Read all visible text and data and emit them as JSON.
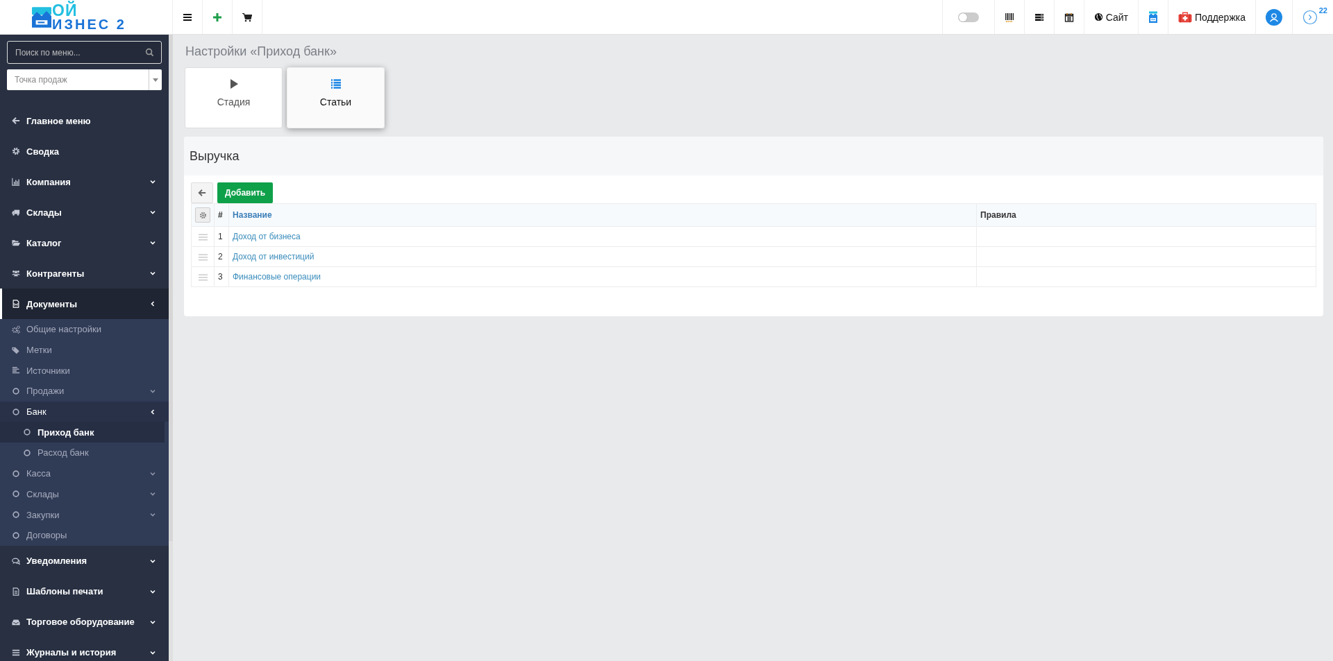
{
  "logo": {
    "line1": "ОЙ",
    "line2": "ИЗНЕС 2"
  },
  "topbar": {
    "toggle": {
      "on": false
    },
    "site_label": "Сайт",
    "support_label": "Поддержка",
    "notification_count": "22"
  },
  "sidebar": {
    "search": {
      "placeholder": "Поиск по меню..."
    },
    "point_select": {
      "placeholder": "Точка продаж"
    },
    "menu": [
      {
        "label": "Главное меню",
        "expandable": false,
        "selected": false
      },
      {
        "label": "Сводка",
        "expandable": false,
        "selected": false
      },
      {
        "label": "Компания",
        "expandable": true,
        "expanded": false,
        "selected": false
      },
      {
        "label": "Склады",
        "expandable": true,
        "expanded": false,
        "selected": false
      },
      {
        "label": "Каталог",
        "expandable": true,
        "expanded": false,
        "selected": false
      },
      {
        "label": "Контрагенты",
        "expandable": true,
        "expanded": false,
        "selected": false
      },
      {
        "label": "Документы",
        "expandable": true,
        "expanded": true,
        "selected": true,
        "children": [
          {
            "label": "Общие настройки",
            "expandable": false,
            "selected": false
          },
          {
            "label": "Метки",
            "expandable": false,
            "selected": false
          },
          {
            "label": "Источники",
            "expandable": false,
            "selected": false
          },
          {
            "label": "Продажи",
            "expandable": true,
            "expanded": false,
            "selected": false
          },
          {
            "label": "Банк",
            "expandable": true,
            "expanded": true,
            "selected": true,
            "children": [
              {
                "label": "Приход банк",
                "expandable": false,
                "selected": true
              },
              {
                "label": "Расход банк",
                "expandable": false,
                "selected": false
              }
            ]
          },
          {
            "label": "Касса",
            "expandable": true,
            "expanded": false,
            "selected": false
          },
          {
            "label": "Склады",
            "expandable": true,
            "expanded": false,
            "selected": false
          },
          {
            "label": "Закупки",
            "expandable": true,
            "expanded": false,
            "selected": false
          },
          {
            "label": "Договоры",
            "expandable": false,
            "selected": false
          }
        ]
      },
      {
        "label": "Уведомления",
        "expandable": true,
        "expanded": false,
        "selected": false
      },
      {
        "label": "Шаблоны печати",
        "expandable": true,
        "expanded": false,
        "selected": false
      },
      {
        "label": "Торговое оборудование",
        "expandable": true,
        "expanded": false,
        "selected": false
      },
      {
        "label": "Журналы и история",
        "expandable": true,
        "expanded": false,
        "selected": false
      }
    ]
  },
  "page_title": "Настройки «Приход банк»",
  "tabs": [
    {
      "label": "Стадия",
      "selected": false
    },
    {
      "label": "Статьи",
      "selected": true
    }
  ],
  "panel": {
    "title": "Выручка",
    "add_button": "Добавить",
    "table": {
      "columns": [
        "#",
        "Название",
        "Правила"
      ],
      "rows": [
        {
          "number": "1",
          "name": "Доход от бизнеса"
        },
        {
          "number": "2",
          "name": "Доход от инвестиций"
        },
        {
          "number": "3",
          "name": "Финансовые операции"
        }
      ]
    }
  }
}
